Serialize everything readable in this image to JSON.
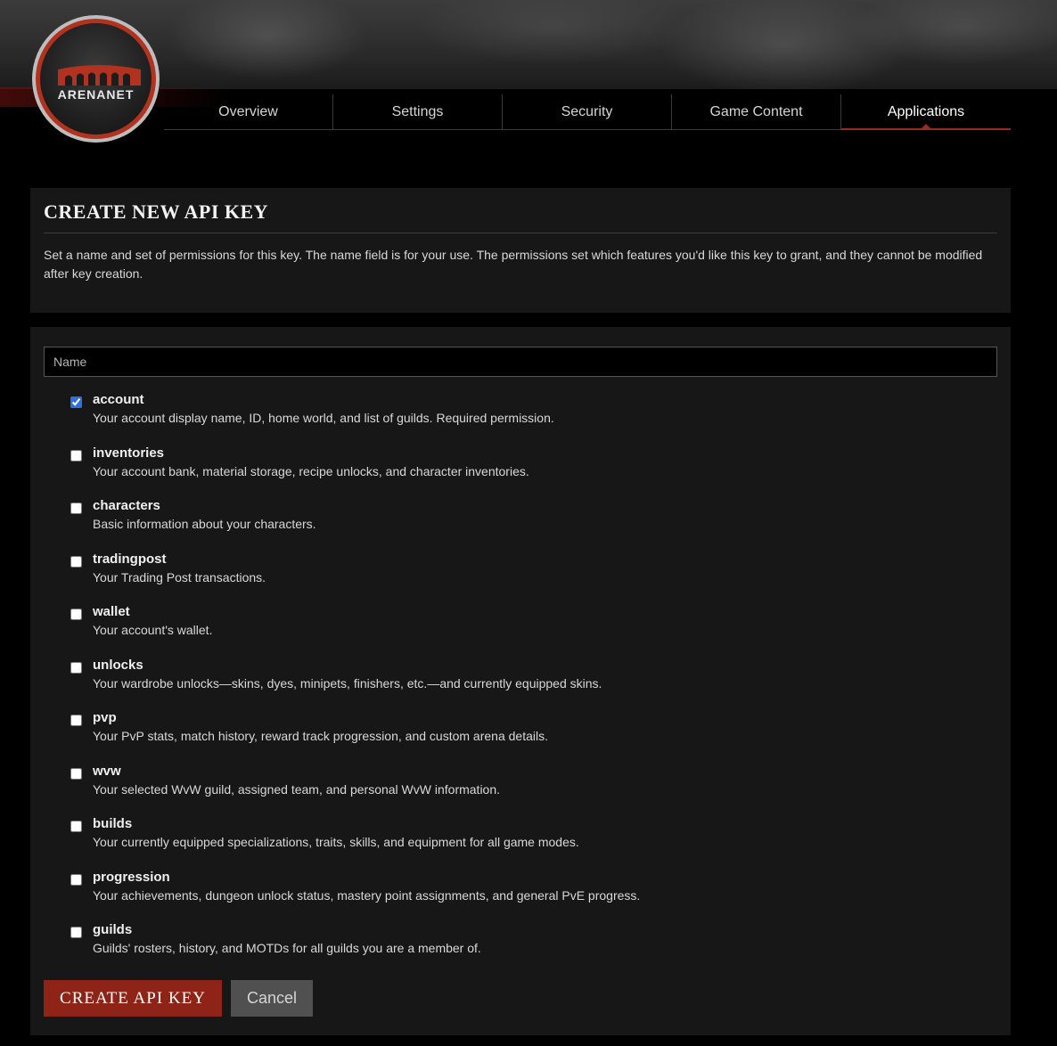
{
  "logo": {
    "text": "ARENANET"
  },
  "nav": {
    "tabs": [
      {
        "label": "Overview"
      },
      {
        "label": "Settings"
      },
      {
        "label": "Security"
      },
      {
        "label": "Game Content"
      },
      {
        "label": "Applications"
      }
    ],
    "active": "Applications"
  },
  "intro": {
    "title": "CREATE NEW API KEY",
    "description": "Set a name and set of permissions for this key. The name field is for your use. The permissions set which features you'd like this key to grant, and they cannot be modified after key creation."
  },
  "form": {
    "name_placeholder": "Name",
    "name_value": "",
    "permissions": [
      {
        "name": "account",
        "desc": "Your account display name, ID, home world, and list of guilds. Required permission.",
        "checked": true
      },
      {
        "name": "inventories",
        "desc": "Your account bank, material storage, recipe unlocks, and character inventories.",
        "checked": false
      },
      {
        "name": "characters",
        "desc": "Basic information about your characters.",
        "checked": false
      },
      {
        "name": "tradingpost",
        "desc": "Your Trading Post transactions.",
        "checked": false
      },
      {
        "name": "wallet",
        "desc": "Your account's wallet.",
        "checked": false
      },
      {
        "name": "unlocks",
        "desc": "Your wardrobe unlocks—skins, dyes, minipets, finishers, etc.—and currently equipped skins.",
        "checked": false
      },
      {
        "name": "pvp",
        "desc": "Your PvP stats, match history, reward track progression, and custom arena details.",
        "checked": false
      },
      {
        "name": "wvw",
        "desc": "Your selected WvW guild, assigned team, and personal WvW information.",
        "checked": false
      },
      {
        "name": "builds",
        "desc": "Your currently equipped specializations, traits, skills, and equipment for all game modes.",
        "checked": false
      },
      {
        "name": "progression",
        "desc": "Your achievements, dungeon unlock status, mastery point assignments, and general PvE progress.",
        "checked": false
      },
      {
        "name": "guilds",
        "desc": "Guilds' rosters, history, and MOTDs for all guilds you are a member of.",
        "checked": false
      }
    ],
    "create_label": "CREATE API KEY",
    "cancel_label": "Cancel"
  },
  "colors": {
    "accent": "#8e2418",
    "checkbox": "#2f6fe4"
  }
}
